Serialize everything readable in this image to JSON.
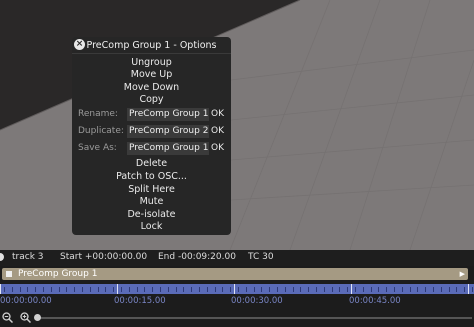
{
  "popup": {
    "title": "PreComp Group 1 - Options",
    "menu_top": [
      "Ungroup",
      "Move Up",
      "Move Down",
      "Copy"
    ],
    "rename": {
      "label": "Rename:",
      "value": "PreComp Group 1",
      "ok": "OK"
    },
    "duplicate": {
      "label": "Duplicate:",
      "value": "PreComp Group 2",
      "ok": "OK"
    },
    "save_as": {
      "label": "Save As:",
      "value": "PreComp Group 1",
      "ok": "OK"
    },
    "menu_bottom": [
      "Delete",
      "Patch to OSC...",
      "Split Here",
      "Mute",
      "De-isolate",
      "Lock"
    ]
  },
  "track": {
    "name": "track 3",
    "start": "Start +00:00:00.00",
    "end": "End -00:09:20.00",
    "tc": "TC 30"
  },
  "clip": {
    "label": "PreComp Group 1"
  },
  "timeline": {
    "times": [
      "00:00:00.00",
      "00:00:15.00",
      "00:00:30.00",
      "00:00:45.00"
    ]
  },
  "icons": [
    "close-icon",
    "clip-icon",
    "zoom-out-icon",
    "zoom-in-icon"
  ],
  "colors": {
    "popup_bg": "#262626",
    "clip": "#a59a83",
    "ruler": "#5a6bb8",
    "viewport": "#8a8686"
  }
}
